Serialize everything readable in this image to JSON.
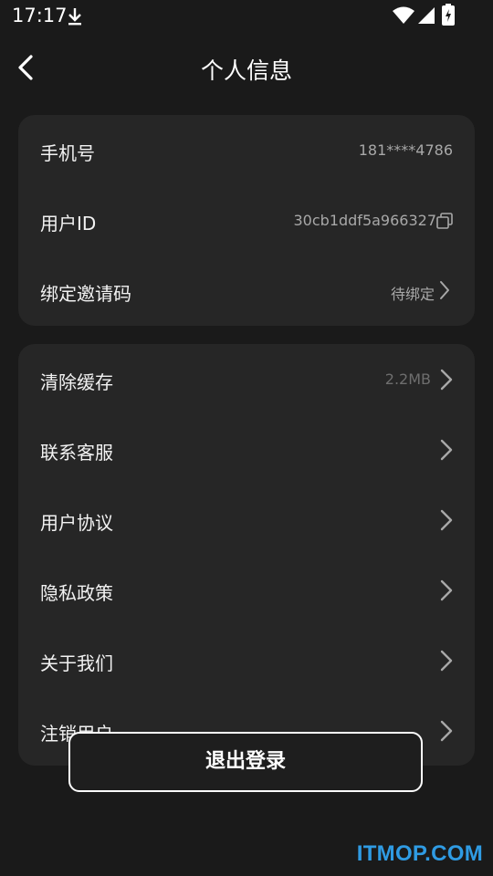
{
  "status_bar": {
    "time": "17:17"
  },
  "header": {
    "title": "个人信息"
  },
  "account": {
    "phone": {
      "label": "手机号",
      "value": "181****4786"
    },
    "user_id": {
      "label": "用户ID",
      "value": "30cb1ddf5a966327"
    },
    "invite_code": {
      "label": "绑定邀请码",
      "value": "待绑定"
    }
  },
  "settings": {
    "clear_cache": {
      "label": "清除缓存",
      "value": "2.2MB"
    },
    "contact": {
      "label": "联系客服"
    },
    "agreement": {
      "label": "用户协议"
    },
    "privacy": {
      "label": "隐私政策"
    },
    "about": {
      "label": "关于我们"
    },
    "delete_account": {
      "label": "注销用户"
    }
  },
  "logout": {
    "label": "退出登录"
  },
  "watermark": "ITMOP.COM",
  "colors": {
    "background": "#1a1a1a",
    "card": "#262626",
    "watermark": "#2f9be3"
  }
}
